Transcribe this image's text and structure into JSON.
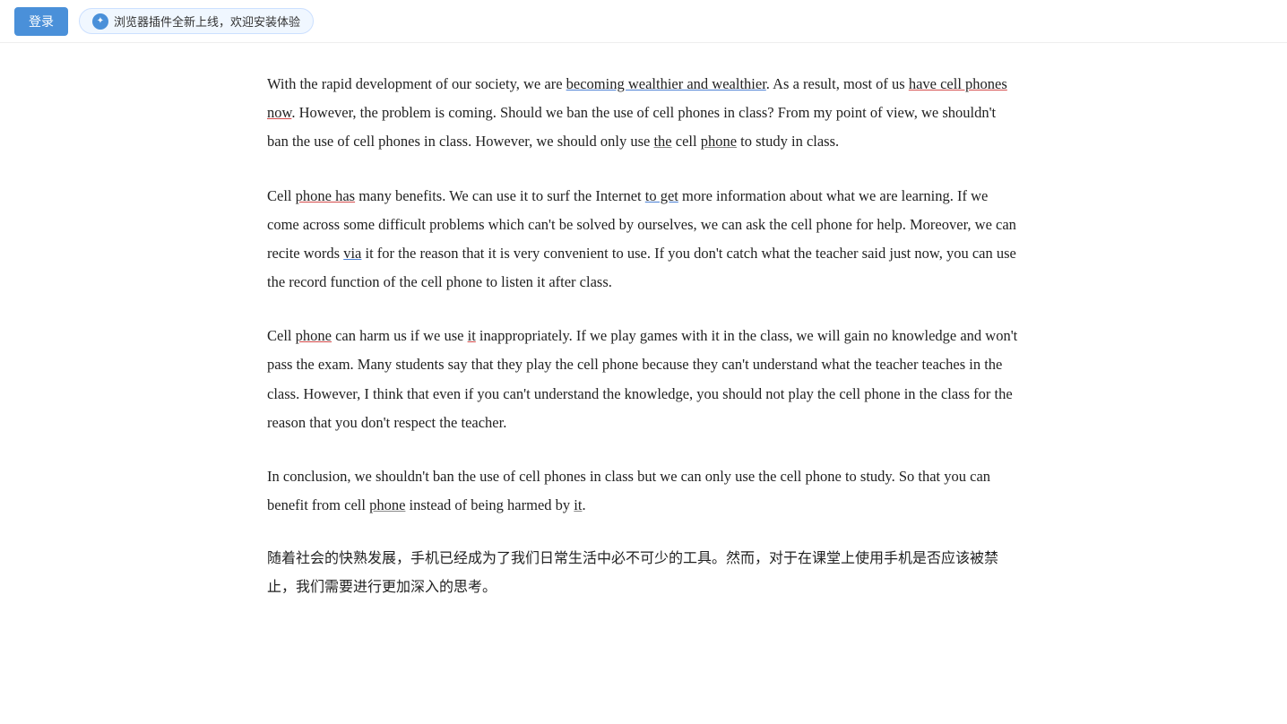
{
  "topbar": {
    "login_label": "登录",
    "plugin_text": "浏览器插件全新上线，欢迎安装体验"
  },
  "article": {
    "paragraph1": {
      "text": "With the rapid development of our society, we are becoming wealthier and wealthier. As a result, most of us have cell phones now. However, the problem is coming. Should we ban the use of cell phones in class? From my point of view, we shouldn't ban the use of cell phones in class. However, we should only use the cell phone to study in class."
    },
    "paragraph2": {
      "text": "Cell phone has many benefits. We can use it to surf the Internet to get more information about what we are learning. If we come across some difficult problems which can't be solved by ourselves, we can ask the cell phone for help. Moreover, we can recite words via it for the reason that it is very convenient to use. If you don't catch what the teacher said just now, you can use the record function of the cell phone to listen it after class."
    },
    "paragraph3": {
      "text": "Cell phone can harm us if we use it inappropriately. If we play games with it in the class, we will gain no knowledge and won't pass the exam. Many students say that they play the cell phone because they can't understand what the teacher teaches in the class. However, I think that even if you can't understand the knowledge, you should not play the cell phone in the class for the reason that you don't respect the teacher."
    },
    "paragraph4": {
      "text": "In conclusion, we shouldn't ban the use of cell phones in class but we can only use the cell phone to study. So that you can benefit from cell phone instead of being harmed by it."
    },
    "paragraph5": {
      "text": "随着社会的快熟发展，手机已经成为了我们日常生活中必不可少的工具。然而，对于在课堂上使用手机是否应该被禁止，我们需要进行更加深入的思考。"
    }
  }
}
